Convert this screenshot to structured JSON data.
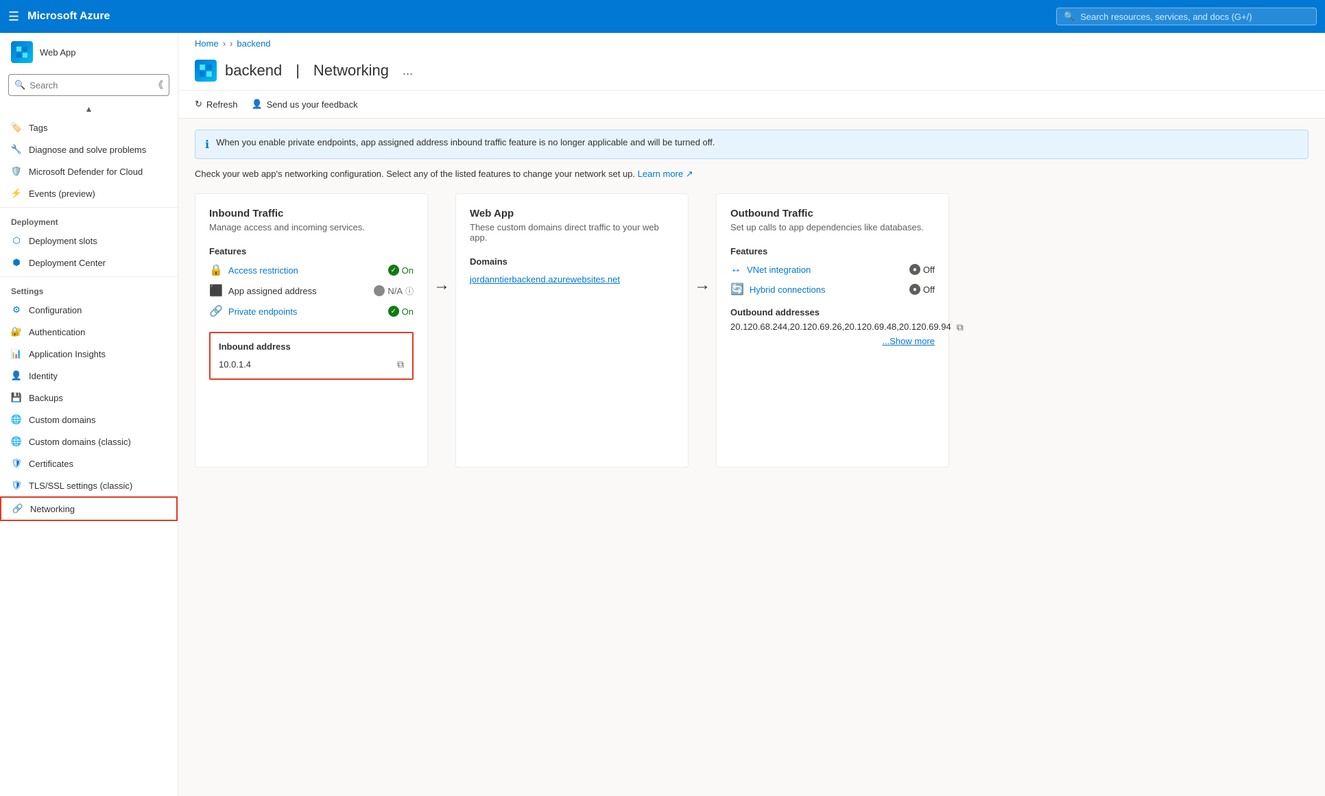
{
  "topnav": {
    "hamburger": "☰",
    "title": "Microsoft Azure",
    "search_placeholder": "Search resources, services, and docs (G+/)"
  },
  "breadcrumb": {
    "home": "Home",
    "sep1": ">",
    "sep2": ">",
    "current": "backend"
  },
  "page": {
    "title": "backend",
    "separator": "|",
    "subtitle": "Networking",
    "ellipsis": "...",
    "app_label": "Web App"
  },
  "toolbar": {
    "refresh": "Refresh",
    "feedback": "Send us your feedback"
  },
  "info_banner": {
    "text": "When you enable private endpoints, app assigned address inbound traffic feature is no longer applicable and will be turned off."
  },
  "description": {
    "text": "Check your web app's networking configuration. Select any of the listed features to change your network set up.",
    "link_text": "Learn more"
  },
  "inbound_card": {
    "title": "Inbound Traffic",
    "subtitle": "Manage access and incoming services.",
    "features_title": "Features",
    "features": [
      {
        "name": "Access restriction",
        "status": "On",
        "type": "on"
      },
      {
        "name": "App assigned address",
        "status": "N/A",
        "type": "na"
      },
      {
        "name": "Private endpoints",
        "status": "On",
        "type": "on"
      }
    ],
    "inbound_address_title": "Inbound address",
    "inbound_address_value": "10.0.1.4"
  },
  "webapp_card": {
    "title": "Web App",
    "subtitle": "These custom domains direct traffic to your web app.",
    "domains_title": "Domains",
    "domain": "jordanntierbackend.azurewebsites.net"
  },
  "outbound_card": {
    "title": "Outbound Traffic",
    "subtitle": "Set up calls to app dependencies like databases.",
    "features_title": "Features",
    "features": [
      {
        "name": "VNet integration",
        "status": "Off",
        "type": "off"
      },
      {
        "name": "Hybrid connections",
        "status": "Off",
        "type": "off"
      }
    ],
    "outbound_addresses_title": "Outbound addresses",
    "outbound_ips": "20.120.68.244,20.120.69.26,20.120.69.48,20.120.69.94",
    "show_more": "...Show more"
  },
  "sidebar": {
    "search_placeholder": "Search",
    "items_top": [
      {
        "label": "Tags",
        "icon": "🏷️"
      },
      {
        "label": "Diagnose and solve problems",
        "icon": "🔧"
      },
      {
        "label": "Microsoft Defender for Cloud",
        "icon": "🛡️"
      },
      {
        "label": "Events (preview)",
        "icon": "⚡"
      }
    ],
    "sections": [
      {
        "name": "Deployment",
        "items": [
          {
            "label": "Deployment slots",
            "icon": "📦"
          },
          {
            "label": "Deployment Center",
            "icon": "📦"
          }
        ]
      },
      {
        "name": "Settings",
        "items": [
          {
            "label": "Configuration",
            "icon": "⚙️"
          },
          {
            "label": "Authentication",
            "icon": "🔐"
          },
          {
            "label": "Application Insights",
            "icon": "📊"
          },
          {
            "label": "Identity",
            "icon": "👤"
          },
          {
            "label": "Backups",
            "icon": "💾"
          },
          {
            "label": "Custom domains",
            "icon": "🌐"
          },
          {
            "label": "Custom domains (classic)",
            "icon": "🌐"
          },
          {
            "label": "Certificates",
            "icon": "🛡️"
          },
          {
            "label": "TLS/SSL settings (classic)",
            "icon": "🛡️"
          },
          {
            "label": "Networking",
            "icon": "🔗",
            "active": true
          }
        ]
      }
    ]
  }
}
